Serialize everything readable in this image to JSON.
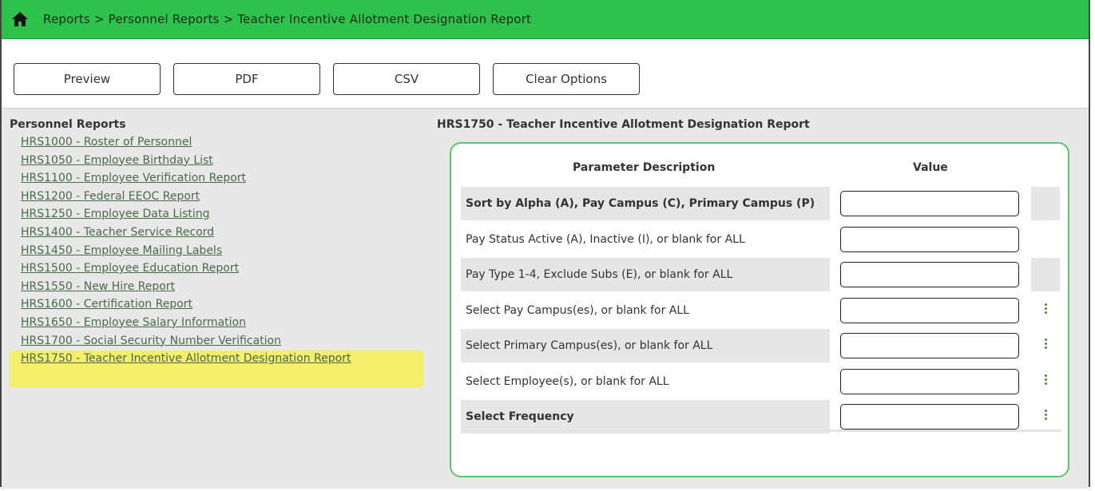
{
  "breadcrumb": "Reports > Personnel Reports > Teacher Incentive Allotment Designation Report",
  "toolbar": {
    "preview": "Preview",
    "pdf": "PDF",
    "csv": "CSV",
    "clear": "Clear Options"
  },
  "sidebar": {
    "title": "Personnel Reports",
    "items": [
      "HRS1000 - Roster of Personnel",
      "HRS1050 - Employee Birthday List",
      "HRS1100 - Employee Verification Report",
      "HRS1200 - Federal EEOC Report",
      "HRS1250 - Employee Data Listing",
      "HRS1400 - Teacher Service Record",
      "HRS1450 - Employee Mailing Labels",
      "HRS1500 - Employee Education Report",
      "HRS1550 - New Hire Report",
      "HRS1600 - Certification Report",
      "HRS1650 - Employee Salary Information",
      "HRS1700 - Social Security Number Verification",
      "HRS1750 - Teacher Incentive Allotment Designation Report"
    ],
    "active_index": 12
  },
  "main": {
    "title": "HRS1750 - Teacher Incentive Allotment Designation Report",
    "header_description": "Parameter Description",
    "header_value": "Value",
    "params": [
      {
        "label": "Sort by Alpha (A), Pay Campus (C), Primary Campus (P)",
        "value": "",
        "bold": true,
        "shaded": true,
        "lookup": false,
        "grayblock": true
      },
      {
        "label": "Pay Status Active (A), Inactive (I), or blank for ALL",
        "value": "",
        "bold": false,
        "shaded": false,
        "lookup": false,
        "grayblock": false
      },
      {
        "label": "Pay Type 1-4, Exclude Subs (E), or blank for ALL",
        "value": "",
        "bold": false,
        "shaded": true,
        "lookup": false,
        "grayblock": true
      },
      {
        "label": "Select Pay Campus(es), or blank for ALL",
        "value": "",
        "bold": false,
        "shaded": false,
        "lookup": true,
        "grayblock": false
      },
      {
        "label": "Select Primary Campus(es), or blank for ALL",
        "value": "",
        "bold": false,
        "shaded": true,
        "lookup": true,
        "grayblock": false
      },
      {
        "label": "Select Employee(s), or blank for ALL",
        "value": "",
        "bold": false,
        "shaded": false,
        "lookup": true,
        "grayblock": false
      },
      {
        "label": "Select Frequency",
        "value": "",
        "bold": true,
        "shaded": true,
        "lookup": true,
        "grayblock": false
      }
    ]
  },
  "colors": {
    "topbar": "#2ec14b",
    "panel_border": "#5bc46f",
    "highlight": "#f4ef6a",
    "link": "#4a6a4a"
  },
  "icons": {
    "home": "home-icon",
    "lookup": "vertical-dots-icon"
  }
}
